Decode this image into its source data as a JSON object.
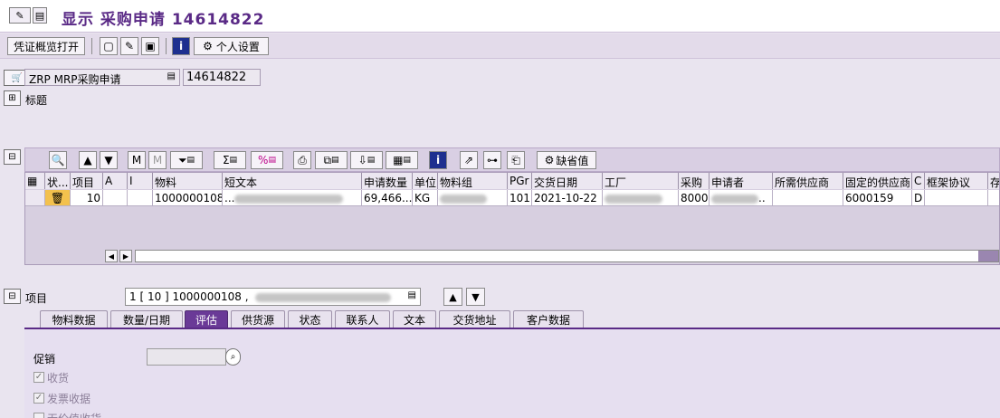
{
  "title_bar": {
    "title": "显示 采购申请 14614822"
  },
  "toolbar": {
    "voucher_overview": "凭证概览打开",
    "personal_settings": "个人设置"
  },
  "header": {
    "doc_type": "ZRP MRP采购申请",
    "doc_number": "14614822",
    "header_section": "标题"
  },
  "grid_toolbar": {
    "default_values": "缺省值"
  },
  "grid": {
    "columns": [
      "状...",
      "项目",
      "A",
      "I",
      "物料",
      "短文本",
      "申请数量",
      "单位",
      "物料组",
      "PGr",
      "交货日期",
      "工厂",
      "采购",
      "申请者",
      "所需供应商",
      "固定的供应商",
      "C",
      "框架协议",
      "存"
    ],
    "row": {
      "item": "10",
      "material": "1000000108",
      "short_text": "...",
      "quantity": "69,466...",
      "unit": "KG",
      "pgr": "101",
      "delivery_date": "2021-10-22",
      "purchasing": "8000",
      "requester_suffix": "..",
      "fixed_vendor": "6000159",
      "c": "D"
    }
  },
  "item_area": {
    "label": "项目",
    "selected": "1 [ 10 ] 1000000108 ,",
    "tabs": [
      "物料数据",
      "数量/日期",
      "评估",
      "供货源",
      "状态",
      "联系人",
      "文本",
      "交货地址",
      "客户数据"
    ],
    "active_tab": "评估"
  },
  "valuation": {
    "promotion_label": "促销",
    "goods_receipt": "收货",
    "invoice_receipt": "发票收据",
    "no_value_receipt": "无价值收货"
  },
  "colors": {
    "title": "#5a2a86",
    "active_tab": "#6a3a97",
    "background": "#e9e4ef"
  }
}
